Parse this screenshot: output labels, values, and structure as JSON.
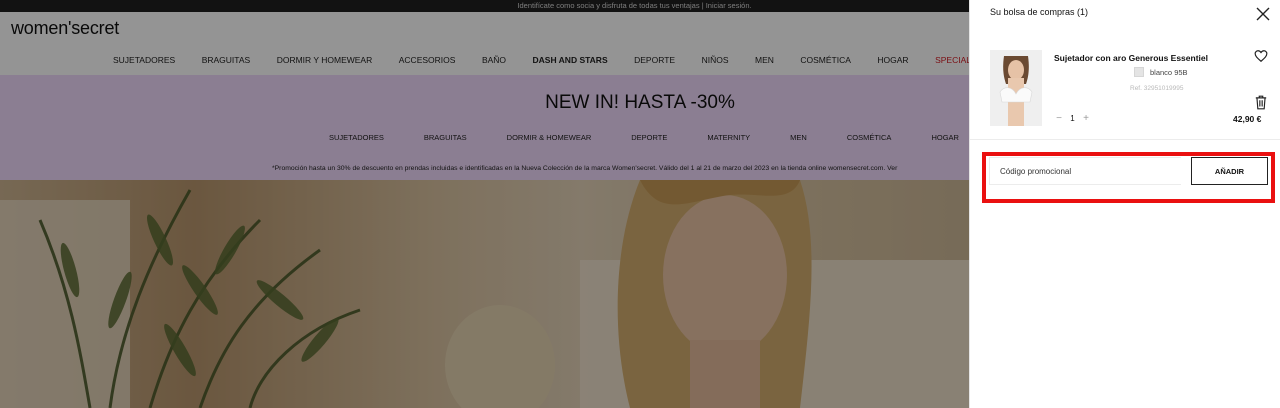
{
  "site": {
    "topbar_text": "Identifícate como socia y disfruta de todas tus ventajas | Iniciar sesión.",
    "logo_text": "women'secret",
    "main_nav": [
      {
        "label": "SUJETADORES"
      },
      {
        "label": "BRAGUITAS"
      },
      {
        "label": "DORMIR Y HOMEWEAR"
      },
      {
        "label": "ACCESORIOS"
      },
      {
        "label": "BAÑO"
      },
      {
        "label": "DASH AND STARS"
      },
      {
        "label": "DEPORTE"
      },
      {
        "label": "NIÑOS"
      },
      {
        "label": "MEN"
      },
      {
        "label": "COSMÉTICA"
      },
      {
        "label": "HOGAR"
      },
      {
        "label": "SPECIAL PRICES"
      }
    ],
    "promo": {
      "title": "NEW IN! HASTA -30%",
      "nav": [
        {
          "label": "SUJETADORES"
        },
        {
          "label": "BRAGUITAS"
        },
        {
          "label": "DORMIR & HOMEWEAR"
        },
        {
          "label": "DEPORTE"
        },
        {
          "label": "MATERNITY"
        },
        {
          "label": "MEN"
        },
        {
          "label": "COSMÉTICA"
        },
        {
          "label": "HOGAR"
        }
      ],
      "note": "*Promoción hasta un 30% de descuento en prendas incluidas e identificadas en la Nueva Colección de la marca Women'secret. Válido del 1 al 21 de marzo del 2023 en la tienda online womensecret.com. Ver"
    }
  },
  "cart": {
    "title": "Su bolsa de compras (1)",
    "item": {
      "name": "Sujetador con aro Generous Essentiel",
      "color": "blanco",
      "size": "95B",
      "ref": "Ref. 32951019995",
      "quantity": "1",
      "price": "42,90 €",
      "minus": "−",
      "plus": "+"
    },
    "promo_code": {
      "placeholder": "Código promocional",
      "button_label": "AÑADIR"
    }
  },
  "colors": {
    "accent_red": "#ea1010",
    "special_prices": "#d31d25",
    "promo_bg": "#efd9fb",
    "overlay": "rgba(0,0,0,0.42)"
  },
  "icons": {
    "close": "close-icon",
    "favorite": "heart-icon",
    "delete": "trash-icon"
  }
}
